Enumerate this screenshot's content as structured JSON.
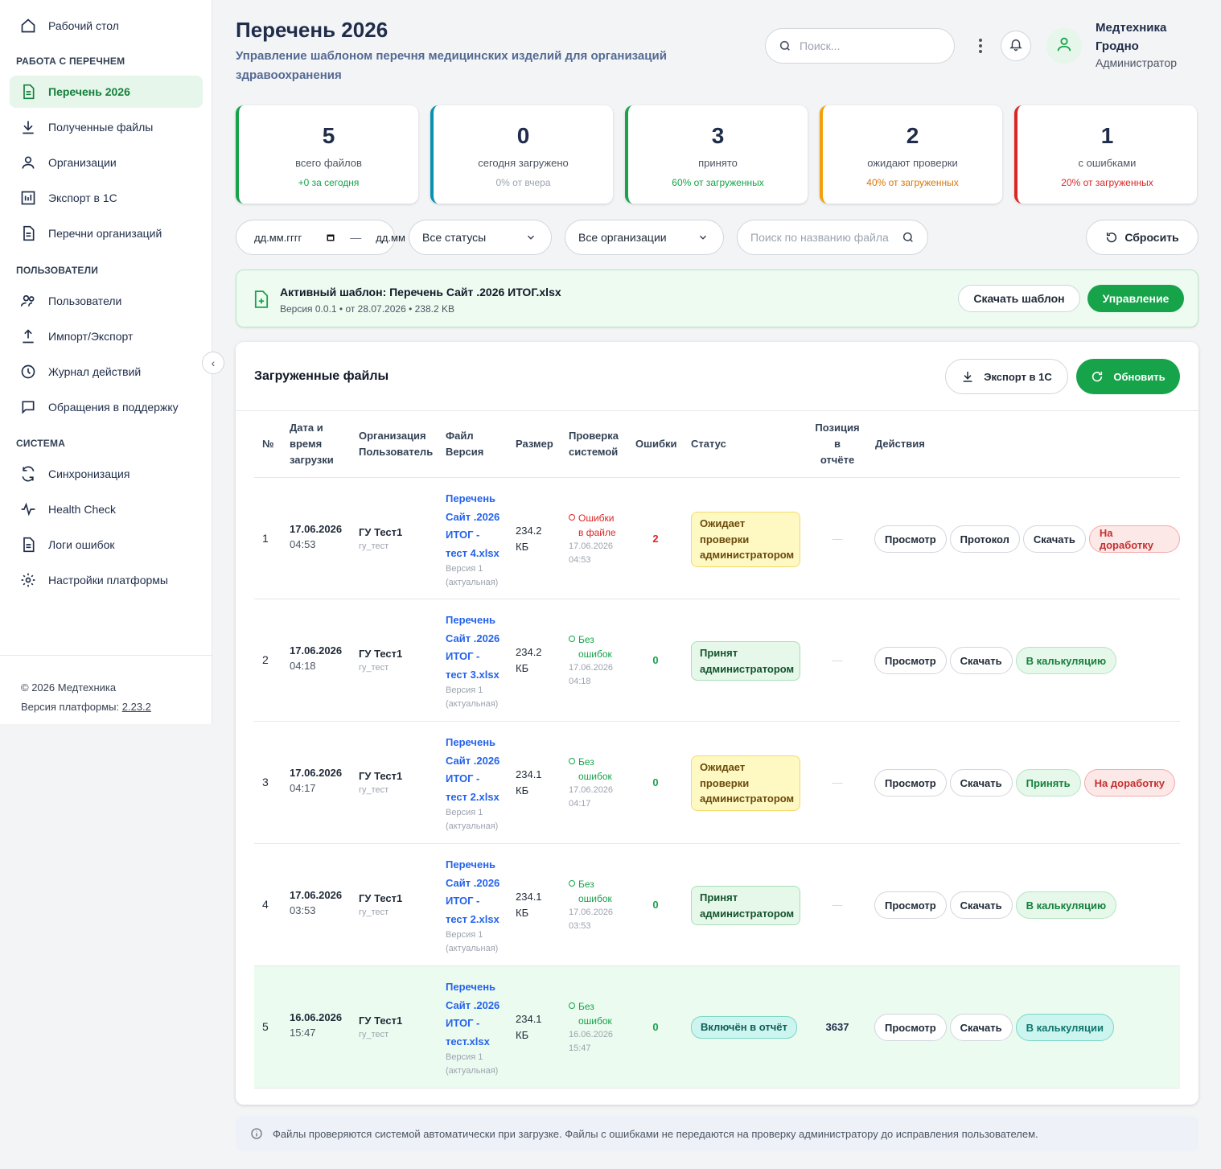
{
  "sidebar": {
    "home": "Рабочий стол",
    "section_list": "РАБОТА С ПЕРЕЧНЕМ",
    "list_items": [
      "Перечень 2026",
      "Полученные файлы",
      "Организации",
      "Экспорт в 1С",
      "Перечни организаций"
    ],
    "section_users": "ПОЛЬЗОВАТЕЛИ",
    "user_items": [
      "Пользователи",
      "Импорт/Экспорт",
      "Журнал действий",
      "Обращения в поддержку"
    ],
    "section_system": "СИСТЕМА",
    "system_items": [
      "Синхронизация",
      "Health Check",
      "Логи ошибок",
      "Настройки платформы"
    ],
    "footer_copy": "© 2026 Медтехника",
    "footer_version_label": "Версия платформы:",
    "footer_version": "2.23.2"
  },
  "header": {
    "title": "Перечень 2026",
    "subtitle": "Управление шаблоном перечня медицинских изделий для организаций здравоохранения",
    "search_placeholder": "Поиск...",
    "user_name": "Медтехника Гродно",
    "user_role": "Администратор"
  },
  "stats": [
    {
      "num": "5",
      "label": "всего файлов",
      "sub": "+0 за сегодня",
      "color": "#16a34a",
      "sub_color": "#16a34a"
    },
    {
      "num": "0",
      "label": "сегодня загружено",
      "sub": "0% от вчера",
      "color": "#0891b2",
      "sub_color": "#9ca3af"
    },
    {
      "num": "3",
      "label": "принято",
      "sub": "60% от загруженных",
      "color": "#16a34a",
      "sub_color": "#16a34a"
    },
    {
      "num": "2",
      "label": "ожидают проверки",
      "sub": "40% от загруженных",
      "color": "#f59e0b",
      "sub_color": "#d97706"
    },
    {
      "num": "1",
      "label": "с ошибками",
      "sub": "20% от загруженных",
      "color": "#dc2626",
      "sub_color": "#dc2626"
    }
  ],
  "filters": {
    "date_from": "дд.мм.гггг",
    "date_sep": "—",
    "date_to": "дд.мм",
    "status": "Все статусы",
    "org": "Все организации",
    "file_search_placeholder": "Поиск по названию файла",
    "reset": "Сбросить"
  },
  "template": {
    "title": "Активный шаблон: Перечень Сайт .2026 ИТОГ.xlsx",
    "meta": "Версия 0.0.1 • от 28.07.2026 • 238.2 KB",
    "download": "Скачать шаблон",
    "manage": "Управление"
  },
  "files": {
    "title": "Загруженные файлы",
    "export_btn": "Экспорт в 1С",
    "refresh_btn": "Обновить",
    "columns": {
      "no": "№",
      "date": [
        "Дата и",
        "время",
        "загрузки"
      ],
      "org": [
        "Организация",
        "Пользователь"
      ],
      "file": [
        "Файл",
        "Версия"
      ],
      "size": "Размер",
      "check": [
        "Проверка",
        "системой"
      ],
      "errors": "Ошибки",
      "status": "Статус",
      "pos": [
        "Позиция",
        "в",
        "отчёте"
      ],
      "actions": "Действия"
    },
    "rows": [
      {
        "no": "1",
        "date": "17.06.2026",
        "time": "04:53",
        "org": "ГУ Тест1",
        "user": "гу_тест",
        "file": [
          "Перечень",
          "Сайт .2026",
          "ИТОГ -",
          "тест 4.xlsx"
        ],
        "ver": [
          "Версия 1",
          "(актуальная)"
        ],
        "size": [
          "234.2",
          "КБ"
        ],
        "check": [
          "Ошибки",
          "в файле"
        ],
        "check_ok": false,
        "check_ts": [
          "17.06.2026",
          "04:53"
        ],
        "errors": "2",
        "status": "Ожидает проверки администратором",
        "status_type": "wait",
        "pos": "—",
        "actions": [
          "Просмотр",
          "Протокол",
          "Скачать",
          "На доработку"
        ]
      },
      {
        "no": "2",
        "date": "17.06.2026",
        "time": "04:18",
        "org": "ГУ Тест1",
        "user": "гу_тест",
        "file": [
          "Перечень",
          "Сайт .2026",
          "ИТОГ -",
          "тест 3.xlsx"
        ],
        "ver": [
          "Версия 1",
          "(актуальная)"
        ],
        "size": [
          "234.2",
          "КБ"
        ],
        "check": [
          "Без",
          "ошибок"
        ],
        "check_ok": true,
        "check_ts": [
          "17.06.2026",
          "04:18"
        ],
        "errors": "0",
        "status": "Принят администратором",
        "status_type": "ok",
        "pos": "—",
        "actions": [
          "Просмотр",
          "Скачать",
          "В калькуляцию"
        ]
      },
      {
        "no": "3",
        "date": "17.06.2026",
        "time": "04:17",
        "org": "ГУ Тест1",
        "user": "гу_тест",
        "file": [
          "Перечень",
          "Сайт .2026",
          "ИТОГ -",
          "тест 2.xlsx"
        ],
        "ver": [
          "Версия 1",
          "(актуальная)"
        ],
        "size": [
          "234.1",
          "КБ"
        ],
        "check": [
          "Без",
          "ошибок"
        ],
        "check_ok": true,
        "check_ts": [
          "17.06.2026",
          "04:17"
        ],
        "errors": "0",
        "status": "Ожидает проверки администратором",
        "status_type": "wait",
        "pos": "—",
        "actions": [
          "Просмотр",
          "Скачать",
          "Принять",
          "На доработку"
        ]
      },
      {
        "no": "4",
        "date": "17.06.2026",
        "time": "03:53",
        "org": "ГУ Тест1",
        "user": "гу_тест",
        "file": [
          "Перечень",
          "Сайт .2026",
          "ИТОГ -",
          "тест 2.xlsx"
        ],
        "ver": [
          "Версия 1",
          "(актуальная)"
        ],
        "size": [
          "234.1",
          "КБ"
        ],
        "check": [
          "Без",
          "ошибок"
        ],
        "check_ok": true,
        "check_ts": [
          "17.06.2026",
          "03:53"
        ],
        "errors": "0",
        "status": "Принят администратором",
        "status_type": "ok",
        "pos": "—",
        "actions": [
          "Просмотр",
          "Скачать",
          "В калькуляцию"
        ]
      },
      {
        "no": "5",
        "date": "16.06.2026",
        "time": "15:47",
        "org": "ГУ Тест1",
        "user": "гу_тест",
        "file": [
          "Перечень",
          "Сайт .2026",
          "ИТОГ -",
          "тест.xlsx"
        ],
        "ver": [
          "Версия 1",
          "(актуальная)"
        ],
        "size": [
          "234.1",
          "КБ"
        ],
        "check": [
          "Без",
          "ошибок"
        ],
        "check_ok": true,
        "check_ts": [
          "16.06.2026",
          "15:47"
        ],
        "errors": "0",
        "status": "Включён в отчёт",
        "status_type": "inc",
        "pos": "3637",
        "actions": [
          "Просмотр",
          "Скачать",
          "В калькуляции"
        ]
      }
    ]
  },
  "info": "Файлы проверяются системой автоматически при загрузке. Файлы с ошибками не передаются на проверку администратору до исправления пользователем.",
  "colors": {
    "accent": "#16a34a",
    "danger": "#dc2626",
    "link": "#2563eb"
  }
}
